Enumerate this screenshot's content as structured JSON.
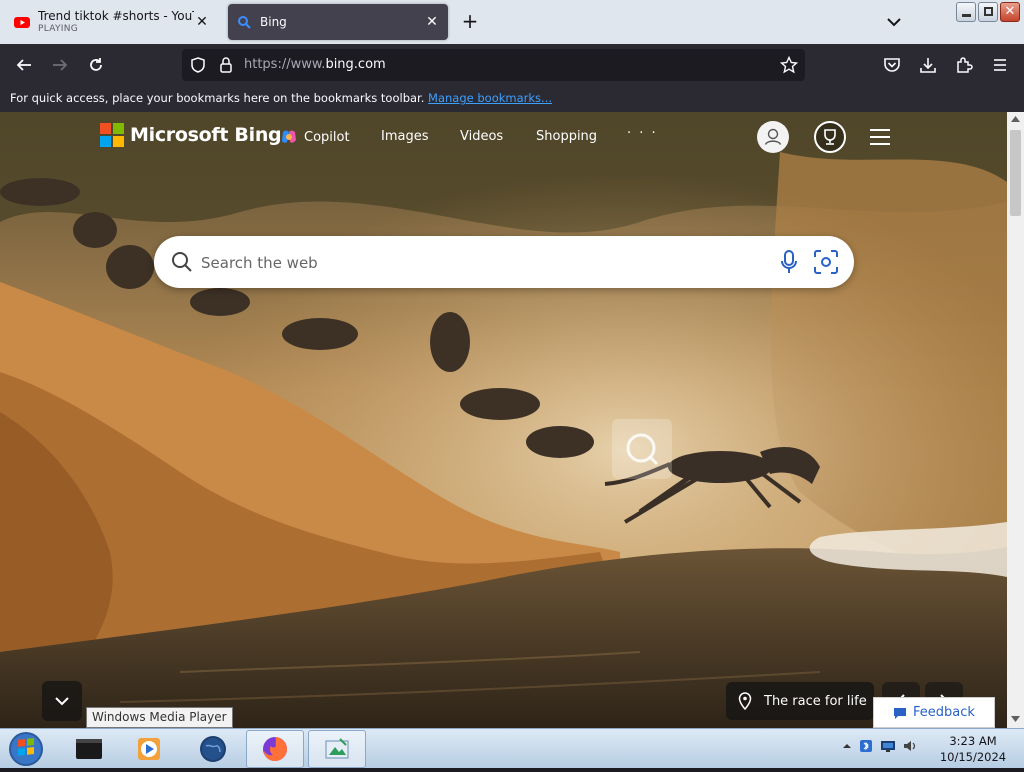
{
  "browser": {
    "tabs": [
      {
        "title": "Trend tiktok #shorts - YouTube",
        "status": "PLAYING",
        "active": false
      },
      {
        "title": "Bing",
        "active": true
      }
    ],
    "url": {
      "prefix": "https://www.",
      "domain": "bing.com"
    },
    "bookmarks_bar": {
      "message": "For quick access, place your bookmarks here on the bookmarks toolbar.",
      "manage_link": "Manage bookmarks..."
    }
  },
  "bing": {
    "brand": "Microsoft Bing",
    "nav": [
      "Copilot",
      "Images",
      "Videos",
      "Shopping"
    ],
    "more": "· · ·",
    "search_placeholder": "Search the web",
    "image_caption": "The race for life",
    "feedback": "Feedback"
  },
  "tooltip": "Windows Media Player",
  "taskbar": {
    "time": "3:23 AM",
    "date": "10/15/2024"
  },
  "colors": {
    "bing_blue": "#2962c4",
    "tab_active": "#42414d",
    "url_bg": "#1c1b22"
  }
}
